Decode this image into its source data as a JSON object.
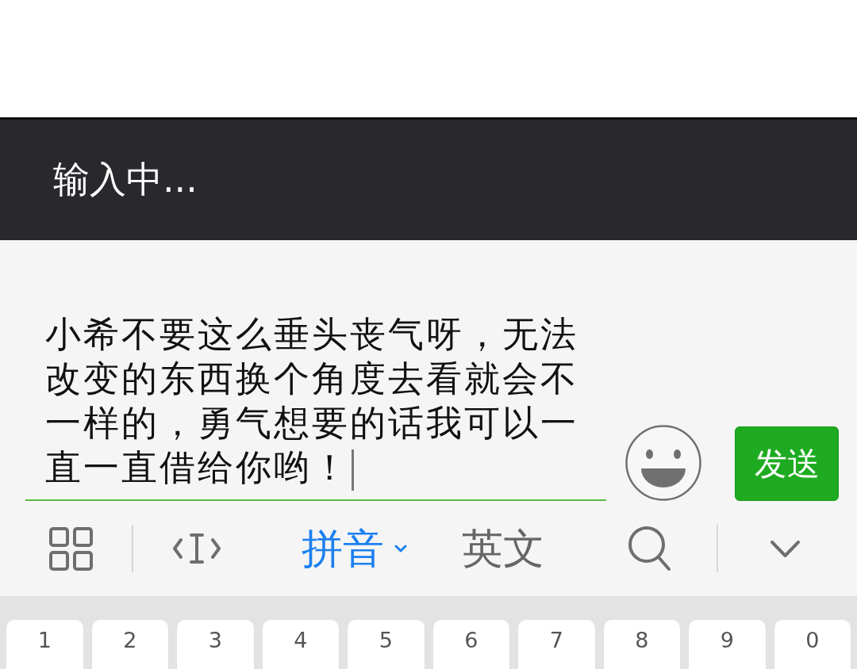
{
  "header": {
    "title": "输入中..."
  },
  "composer": {
    "value": "小希不要这么垂头丧气呀，无法改变的东西换个角度去看就会不一样的，勇气想要的话我可以一直一直借给你哟！",
    "focused": true,
    "send_label": "发送"
  },
  "toolbar": [
    {
      "kind": "menu"
    },
    {
      "kind": "divider"
    },
    {
      "kind": "cursor"
    },
    {
      "kind": "mode",
      "label": "拼音",
      "selected": true,
      "dropdown": true
    },
    {
      "kind": "mode",
      "label": "英文",
      "selected": false,
      "dropdown": false
    },
    {
      "kind": "search"
    },
    {
      "kind": "divider"
    },
    {
      "kind": "collapse"
    }
  ],
  "keyboard": {
    "keys": [
      "1",
      "2",
      "3",
      "4",
      "5",
      "6",
      "7",
      "8",
      "9",
      "0"
    ]
  }
}
